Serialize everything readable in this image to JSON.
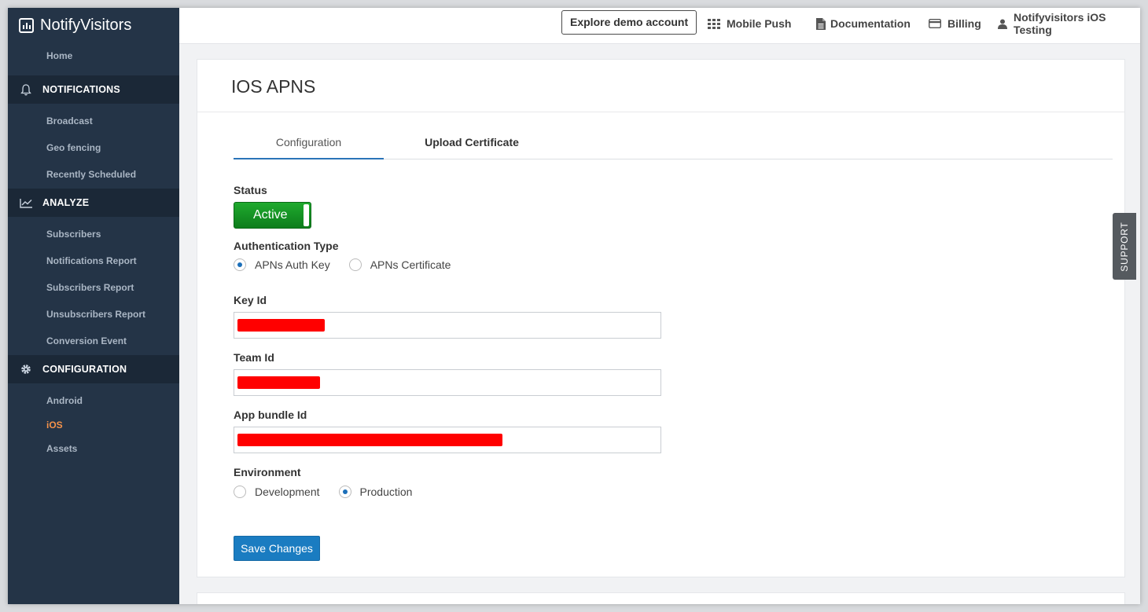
{
  "app": {
    "logo_text": "NotifyVisitors"
  },
  "sidebar": {
    "home": "Home",
    "sections": {
      "notifications": {
        "label": "NOTIFICATIONS",
        "items": [
          "Broadcast",
          "Geo fencing",
          "Recently Scheduled"
        ]
      },
      "analyze": {
        "label": "ANALYZE",
        "items": [
          "Subscribers",
          "Notifications Report",
          "Subscribers Report",
          "Unsubscribers Report",
          "Conversion Event"
        ]
      },
      "configuration": {
        "label": "CONFIGURATION",
        "items": [
          "Android",
          "iOS",
          "Assets"
        ],
        "active_item": "iOS"
      }
    }
  },
  "topbar": {
    "demo_button": "Explore demo account",
    "mobile_push": "Mobile Push",
    "documentation": "Documentation",
    "billing": "Billing",
    "account": "Notifyvisitors iOS Testing"
  },
  "page": {
    "title": "IOS APNS",
    "tabs": [
      "Configuration",
      "Upload Certificate"
    ],
    "active_tab": "Configuration",
    "status": {
      "label": "Status",
      "value": "Active"
    },
    "auth_type": {
      "label": "Authentication Type",
      "options": [
        "APNs Auth Key",
        "APNs Certificate"
      ],
      "selected": "APNs Auth Key"
    },
    "key_id": {
      "label": "Key Id"
    },
    "team_id": {
      "label": "Team Id"
    },
    "bundle_id": {
      "label": "App bundle Id"
    },
    "environment": {
      "label": "Environment",
      "options": [
        "Development",
        "Production"
      ],
      "selected": "Production"
    },
    "save_button": "Save Changes"
  },
  "support_tab": "SUPPORT",
  "colors": {
    "sidebar_bg": "#243447",
    "active_nav": "#f5924a",
    "toggle_active": "#15942a",
    "primary_button": "#1a7cc1",
    "redaction": "#ff0000"
  }
}
